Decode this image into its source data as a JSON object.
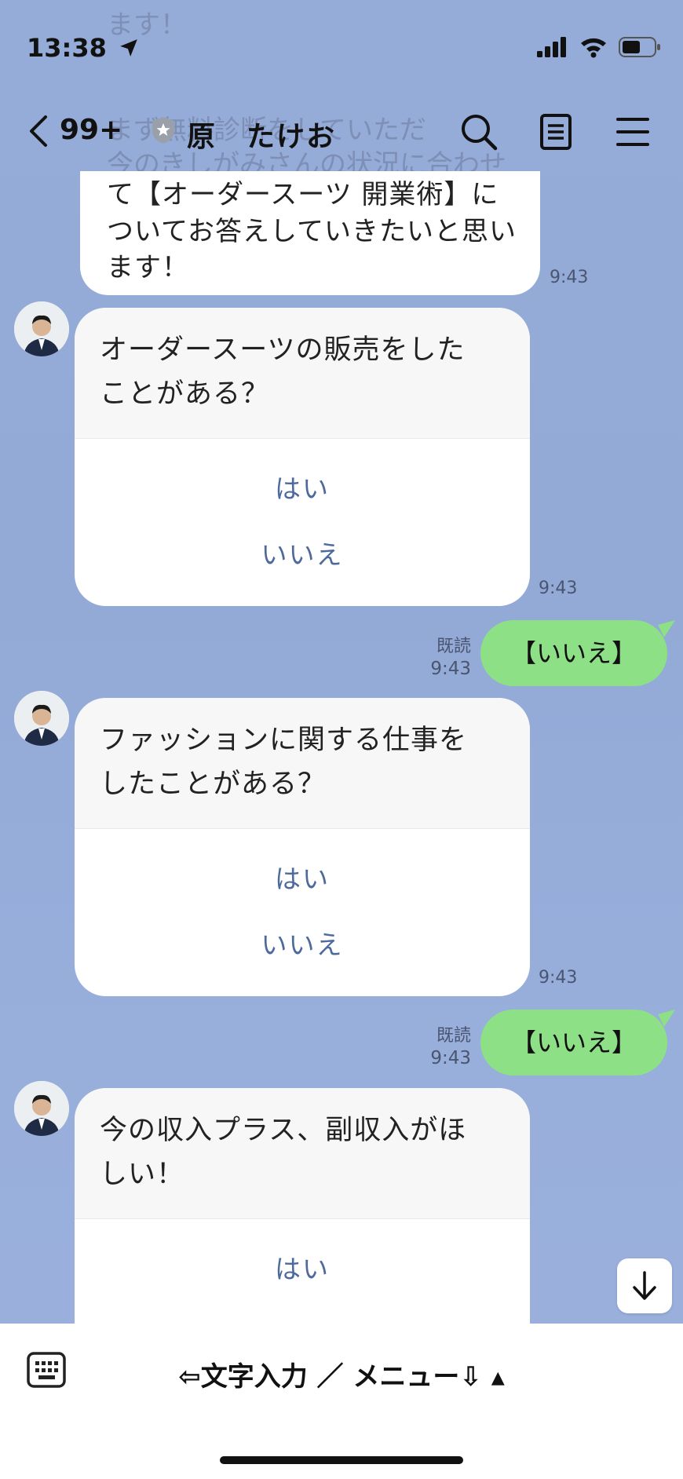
{
  "status": {
    "time": "13:38"
  },
  "header": {
    "unread_count": "99+",
    "chat_name": "原　たけお",
    "icons": [
      "back-chevron-icon",
      "verified-badge-icon",
      "search-icon",
      "notes-icon",
      "menu-icon"
    ]
  },
  "ghost_lines": [
    "ます！",
    "まず無料診断をしていただ",
    "今のきしがみさんの状況に合わせ"
  ],
  "messages": {
    "intro": {
      "lines": [
        "て【オーダースーツ 開業術】に",
        "ついてお答えしていきたいと思い",
        "ます！"
      ],
      "time": "9:43"
    },
    "q1": {
      "question": [
        "オーダースーツの販売をした",
        "ことがある？"
      ],
      "yes": "はい",
      "no": "いいえ",
      "time": "9:43"
    },
    "a1": {
      "read": "既読",
      "time": "9:43",
      "text": "【いいえ】"
    },
    "q2": {
      "question": [
        "ファッションに関する仕事を",
        "したことがある？"
      ],
      "yes": "はい",
      "no": "いいえ",
      "time": "9:43"
    },
    "a2": {
      "read": "既読",
      "time": "9:43",
      "text": "【いいえ】"
    },
    "q3": {
      "question": [
        "今の収入プラス、副収入がほ",
        "しい！"
      ],
      "yes": "はい"
    }
  },
  "footer": {
    "menu_label": "⇦文字入力 ／ メニュー⇩ ▴"
  },
  "colors": {
    "background": "#96acd8",
    "sent_bubble": "#8de085",
    "option_text": "#4e6a9c"
  }
}
